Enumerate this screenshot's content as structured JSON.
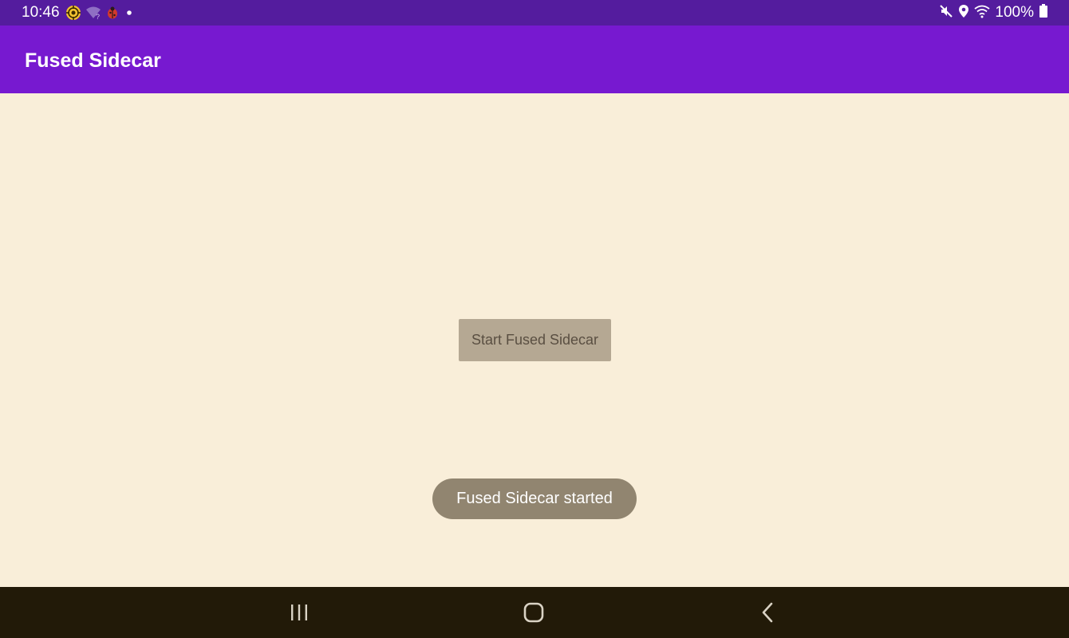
{
  "status_bar": {
    "time": "10:46",
    "left_icons": [
      "target-app-icon",
      "wifi-question-icon",
      "bug-app-icon",
      "notification-dot-icon"
    ],
    "right_icons": [
      "mute-icon",
      "location-icon",
      "wifi-icon",
      "battery-icon"
    ],
    "battery_percent": "100%"
  },
  "app_bar": {
    "title": "Fused Sidecar"
  },
  "main": {
    "start_button_label": "Start Fused Sidecar"
  },
  "toast": {
    "message": "Fused Sidecar started"
  },
  "nav_bar": {
    "buttons": [
      "recents",
      "home",
      "back"
    ]
  },
  "colors": {
    "status_bar": "#541c9e",
    "app_bar": "#7719d0",
    "background": "#f9eed9",
    "button": "#b5a893",
    "toast": "#918570",
    "nav_bar": "#221a08"
  }
}
